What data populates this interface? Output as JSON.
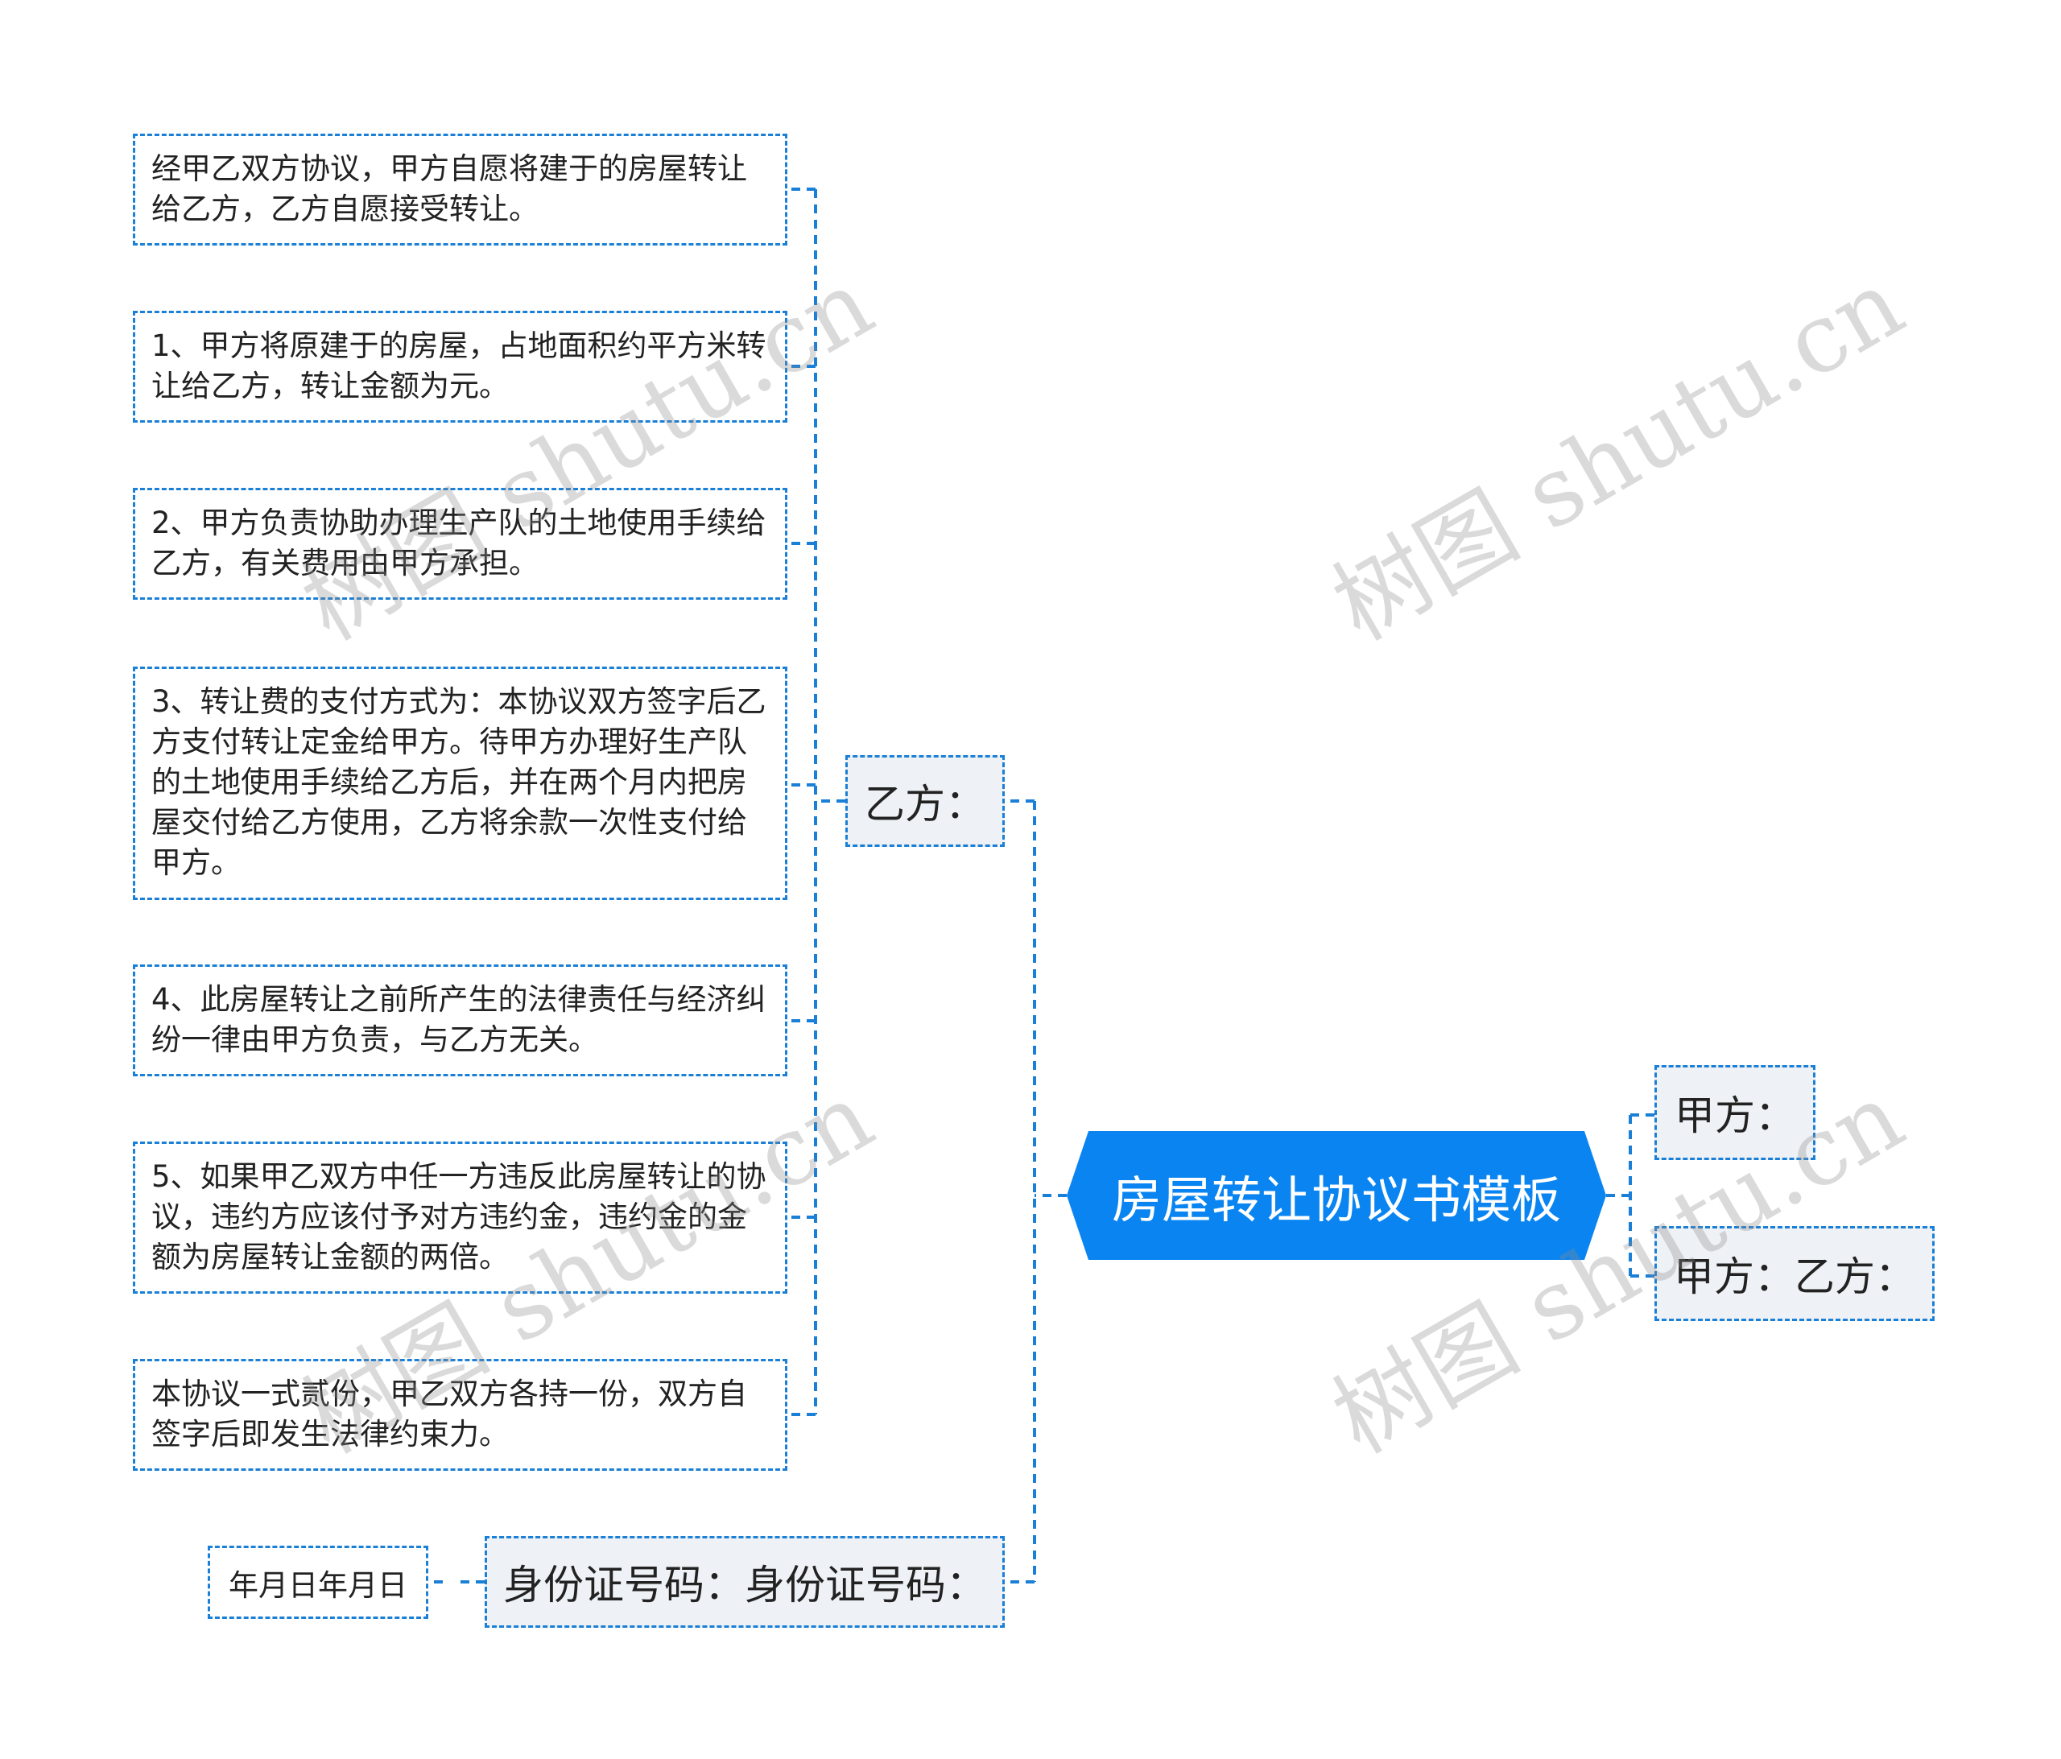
{
  "root": {
    "title": "房屋转让协议书模板"
  },
  "branches": {
    "yifang": {
      "label": "乙方：",
      "items": [
        "经甲乙双方协议，甲方自愿将建于的房屋转让给乙方，乙方自愿接受转让。",
        "1、甲方将原建于的房屋，占地面积约平方米转让给乙方，转让金额为元。",
        "2、甲方负责协助办理生产队的土地使用手续给乙方，有关费用由甲方承担。",
        "3、转让费的支付方式为：本协议双方签字后乙方支付转让定金给甲方。待甲方办理好生产队的土地使用手续给乙方后，并在两个月内把房屋交付给乙方使用，乙方将余款一次性支付给甲方。",
        "4、此房屋转让之前所产生的法律责任与经济纠纷一律由甲方负责，与乙方无关。",
        "5、如果甲乙双方中任一方违反此房屋转让的协议，违约方应该付予对方违约金，违约金的金额为房屋转让金额的两倍。",
        "本协议一式贰份，甲乙双方各持一份，双方自签字后即发生法律约束力。"
      ]
    },
    "idcard": {
      "label": "身份证号码：身份证号码：",
      "child": "年月日年月日"
    },
    "jiafang": {
      "label": "甲方："
    },
    "jiafang_yifang": {
      "label": "甲方：乙方："
    }
  },
  "watermark": "树图 shutu.cn",
  "colors": {
    "root_fill": "#0984f1",
    "line": "#1a7fd6",
    "branch_fill": "#eef1f5"
  }
}
